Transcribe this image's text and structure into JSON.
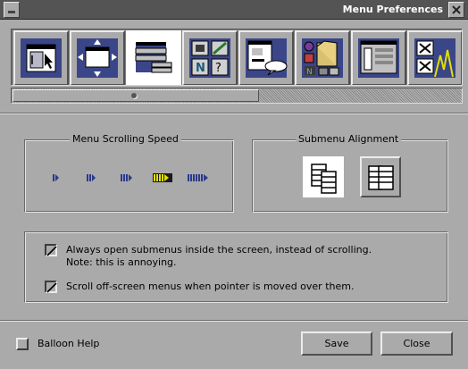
{
  "window": {
    "title": "Menu Preferences"
  },
  "toolbar": {
    "items": [
      {
        "name": "window-frame-prefs-icon"
      },
      {
        "name": "window-move-prefs-icon"
      },
      {
        "name": "menu-prefs-icon",
        "selected": true
      },
      {
        "name": "desktop-tools-icon"
      },
      {
        "name": "balloon-help-prefs-icon"
      },
      {
        "name": "appearance-prefs-icon"
      },
      {
        "name": "window-list-prefs-icon"
      },
      {
        "name": "background-prefs-icon"
      }
    ]
  },
  "speed": {
    "title": "Menu Scrolling Speed",
    "levels": 5,
    "selected_index": 3,
    "color": "#2a3a8c",
    "selected_color": "#e0e000"
  },
  "alignment": {
    "title": "Submenu Alignment",
    "options": [
      {
        "name": "align-top-option",
        "selected": true
      },
      {
        "name": "align-center-option",
        "selected": false
      }
    ]
  },
  "options": {
    "submenu_inside_line1": "Always open submenus inside the screen, instead of scrolling.",
    "submenu_inside_line2": "Note: this is annoying.",
    "submenu_inside_checked": true,
    "scroll_offscreen": "Scroll off-screen menus when pointer is moved over them.",
    "scroll_offscreen_checked": true
  },
  "footer": {
    "balloon_help": "Balloon Help",
    "balloon_help_checked": false,
    "save": "Save",
    "close": "Close"
  }
}
